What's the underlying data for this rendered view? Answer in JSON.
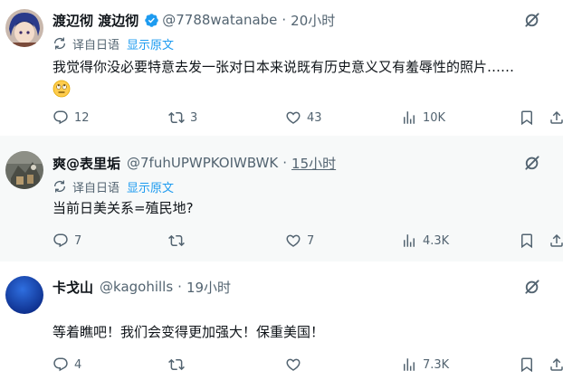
{
  "tweets": [
    {
      "display_name": "渡辺彻 渡边彻",
      "handle": "@7788watanabe",
      "time": "20小时",
      "verified": true,
      "translate_label": "译自日语",
      "show_original": "显示原文",
      "text_line1": "我觉得你没必要特意去发一张对日本来说既有历史意义又有羞辱性的照片……",
      "replies": "12",
      "reposts": "3",
      "likes": "43",
      "views": "10K"
    },
    {
      "display_name": "爽@表里垢",
      "handle": "@7fuhUPWPKOIWBWK",
      "time": "15小时",
      "translate_label": "译自日语",
      "show_original": "显示原文",
      "text_line1": "当前日美关系=殖民地?",
      "replies": "7",
      "reposts": "",
      "likes": "7",
      "views": "4.3K"
    },
    {
      "display_name": "卡戈山",
      "handle": "@kagohills",
      "time": "19小时",
      "text_line1": "等着瞧吧！我们会变得更加强大！保重美国！",
      "replies": "4",
      "reposts": "",
      "likes": "",
      "views": "7.3K"
    }
  ],
  "dot": "·",
  "icons": {
    "reply": "reply-icon",
    "repost": "repost-icon",
    "like": "like-icon",
    "views": "views-icon",
    "bookmark": "bookmark-icon",
    "share": "share-icon",
    "grok": "grok-icon",
    "translate": "translate-icon",
    "verified": "verified-badge-icon"
  },
  "colors": {
    "accent": "#1d9bf0",
    "muted": "#536471",
    "text": "#0f1419",
    "hover_bg": "#f7f9f9"
  }
}
